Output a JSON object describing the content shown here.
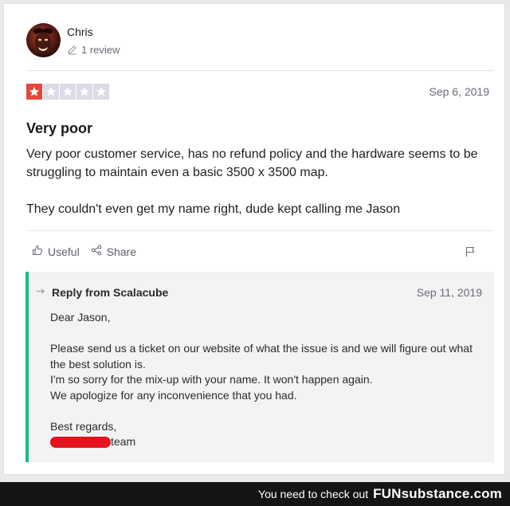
{
  "reviewer": {
    "name": "Chris",
    "review_count": "1 review",
    "avatar_icon": "avatar-image"
  },
  "review": {
    "rating": 1,
    "rating_max": 5,
    "star_on_color": "#e4483a",
    "star_off_color": "#dcdce6",
    "date": "Sep 6, 2019",
    "title": "Very poor",
    "paragraphs": [
      "Very poor customer service, has no refund policy and the hardware seems to be struggling to maintain even a basic 3500 x 3500 map.",
      "They couldn't even get my name right, dude kept calling me Jason"
    ]
  },
  "actions": {
    "useful_label": "Useful",
    "share_label": "Share",
    "useful_icon": "thumbs-up-icon",
    "share_icon": "share-icon",
    "flag_icon": "flag-icon"
  },
  "reply": {
    "title": "Reply from Scalacube",
    "date": "Sep 11, 2019",
    "accent_color": "#08c28b",
    "greeting": "Dear Jason,",
    "lines": [
      "Please send us a ticket on our website of what the issue is and we will figure out what the best solution is.",
      "I'm so sorry for the mix-up with your name. It won't happen again.",
      "We apologize for any inconvenience that you had."
    ],
    "closing": "Best regards,",
    "signature_suffix": "team"
  },
  "footer": {
    "text": "You need to check out",
    "brand": "FUNsubstance.com"
  }
}
